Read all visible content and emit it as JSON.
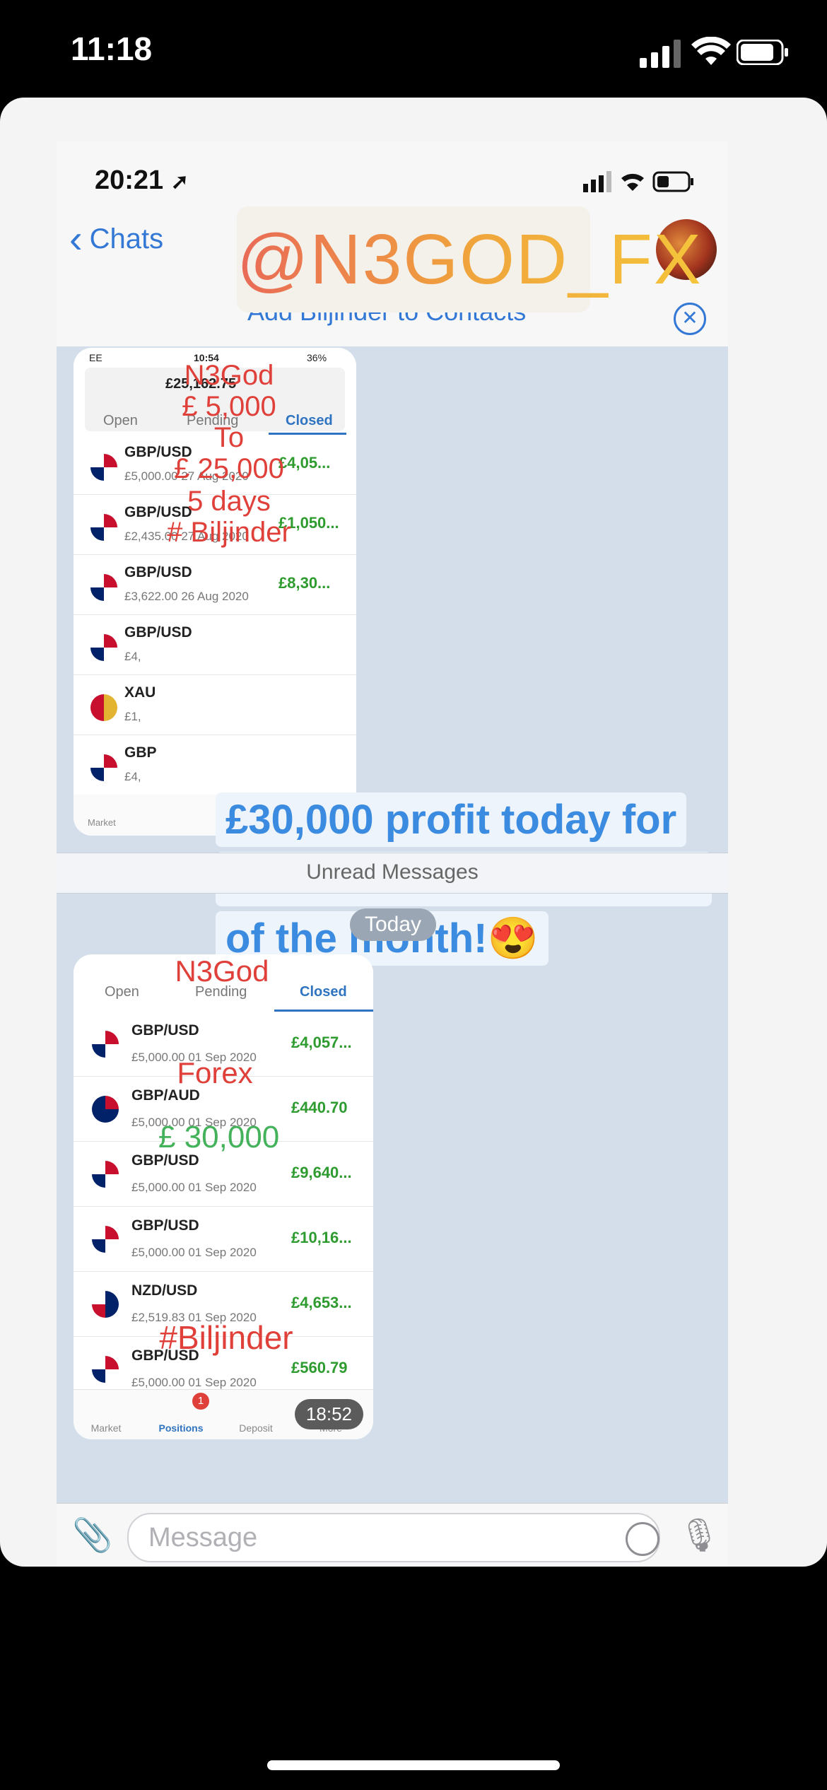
{
  "os_status": {
    "time": "11:18"
  },
  "inner_status": {
    "time": "20:21"
  },
  "nav": {
    "back_label": "Chats",
    "add_contact": "Add Biljinder to Contacts"
  },
  "handle_tag": "@N3GOD_FX",
  "top_shot": {
    "status_left": "EE",
    "status_time": "10:54",
    "status_batt": "36%",
    "balance": "£25,162.75",
    "tabs": [
      "Open",
      "Pending",
      "Closed"
    ],
    "rows": [
      {
        "pair": "GBP/USD",
        "sub": "£5,000.00 27 Aug 2020",
        "pnl": "£4,05..."
      },
      {
        "pair": "GBP/USD",
        "sub": "£2,435.00 27 Aug 2020",
        "pnl": "£1,050..."
      },
      {
        "pair": "GBP/USD",
        "sub": "£3,622.00 26 Aug 2020",
        "pnl": "£8,30..."
      },
      {
        "pair": "GBP/USD",
        "sub": "£4,",
        "pnl": ""
      },
      {
        "pair": "XAU",
        "sub": "£1,",
        "pnl": ""
      },
      {
        "pair": "GBP",
        "sub": "£4,",
        "pnl": ""
      }
    ],
    "overlay_lines": [
      "N3God",
      "£ 5,000",
      "To",
      "£ 25,000",
      "5 days",
      "# Biljinder"
    ],
    "market_label": "Market"
  },
  "message_text": "£30,000 profit today for this member! Great start of the month!😍",
  "unread_label": "Unread Messages",
  "today_label": "Today",
  "bottom_shot": {
    "tabs": [
      "Open",
      "Pending",
      "Closed"
    ],
    "rows": [
      {
        "pair": "GBP/USD",
        "sub": "£5,000.00 01 Sep 2020",
        "pnl": "£4,057..."
      },
      {
        "pair": "GBP/AUD",
        "sub": "£5,000.00 01 Sep 2020",
        "pnl": "£440.70"
      },
      {
        "pair": "GBP/USD",
        "sub": "£5,000.00 01 Sep 2020",
        "pnl": "£9,640..."
      },
      {
        "pair": "GBP/USD",
        "sub": "£5,000.00 01 Sep 2020",
        "pnl": "£10,16..."
      },
      {
        "pair": "NZD/USD",
        "sub": "£2,519.83 01 Sep 2020",
        "pnl": "£4,653..."
      },
      {
        "pair": "GBP/USD",
        "sub": "£5,000.00 01 Sep 2020",
        "pnl": "£560.79"
      }
    ],
    "overlay_title": "N3God",
    "overlay_forex": "Forex",
    "overlay_amount": "£ 30,000",
    "overlay_tag": "#Biljinder",
    "nav": [
      "Market",
      "Positions",
      "Deposit",
      "More"
    ],
    "badge": "1",
    "time": "18:52"
  },
  "input": {
    "placeholder": "Message"
  }
}
